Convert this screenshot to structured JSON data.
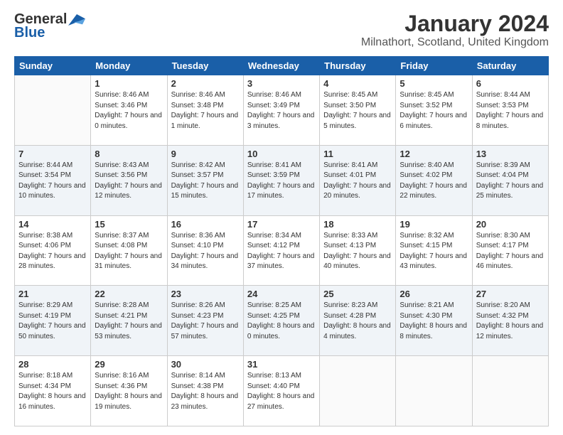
{
  "header": {
    "logo_general": "General",
    "logo_blue": "Blue",
    "month": "January 2024",
    "location": "Milnathort, Scotland, United Kingdom"
  },
  "weekdays": [
    "Sunday",
    "Monday",
    "Tuesday",
    "Wednesday",
    "Thursday",
    "Friday",
    "Saturday"
  ],
  "weeks": [
    [
      {
        "day": "",
        "sunrise": "",
        "sunset": "",
        "daylight": ""
      },
      {
        "day": "1",
        "sunrise": "Sunrise: 8:46 AM",
        "sunset": "Sunset: 3:46 PM",
        "daylight": "Daylight: 7 hours and 0 minutes."
      },
      {
        "day": "2",
        "sunrise": "Sunrise: 8:46 AM",
        "sunset": "Sunset: 3:48 PM",
        "daylight": "Daylight: 7 hours and 1 minute."
      },
      {
        "day": "3",
        "sunrise": "Sunrise: 8:46 AM",
        "sunset": "Sunset: 3:49 PM",
        "daylight": "Daylight: 7 hours and 3 minutes."
      },
      {
        "day": "4",
        "sunrise": "Sunrise: 8:45 AM",
        "sunset": "Sunset: 3:50 PM",
        "daylight": "Daylight: 7 hours and 5 minutes."
      },
      {
        "day": "5",
        "sunrise": "Sunrise: 8:45 AM",
        "sunset": "Sunset: 3:52 PM",
        "daylight": "Daylight: 7 hours and 6 minutes."
      },
      {
        "day": "6",
        "sunrise": "Sunrise: 8:44 AM",
        "sunset": "Sunset: 3:53 PM",
        "daylight": "Daylight: 7 hours and 8 minutes."
      }
    ],
    [
      {
        "day": "7",
        "sunrise": "Sunrise: 8:44 AM",
        "sunset": "Sunset: 3:54 PM",
        "daylight": "Daylight: 7 hours and 10 minutes."
      },
      {
        "day": "8",
        "sunrise": "Sunrise: 8:43 AM",
        "sunset": "Sunset: 3:56 PM",
        "daylight": "Daylight: 7 hours and 12 minutes."
      },
      {
        "day": "9",
        "sunrise": "Sunrise: 8:42 AM",
        "sunset": "Sunset: 3:57 PM",
        "daylight": "Daylight: 7 hours and 15 minutes."
      },
      {
        "day": "10",
        "sunrise": "Sunrise: 8:41 AM",
        "sunset": "Sunset: 3:59 PM",
        "daylight": "Daylight: 7 hours and 17 minutes."
      },
      {
        "day": "11",
        "sunrise": "Sunrise: 8:41 AM",
        "sunset": "Sunset: 4:01 PM",
        "daylight": "Daylight: 7 hours and 20 minutes."
      },
      {
        "day": "12",
        "sunrise": "Sunrise: 8:40 AM",
        "sunset": "Sunset: 4:02 PM",
        "daylight": "Daylight: 7 hours and 22 minutes."
      },
      {
        "day": "13",
        "sunrise": "Sunrise: 8:39 AM",
        "sunset": "Sunset: 4:04 PM",
        "daylight": "Daylight: 7 hours and 25 minutes."
      }
    ],
    [
      {
        "day": "14",
        "sunrise": "Sunrise: 8:38 AM",
        "sunset": "Sunset: 4:06 PM",
        "daylight": "Daylight: 7 hours and 28 minutes."
      },
      {
        "day": "15",
        "sunrise": "Sunrise: 8:37 AM",
        "sunset": "Sunset: 4:08 PM",
        "daylight": "Daylight: 7 hours and 31 minutes."
      },
      {
        "day": "16",
        "sunrise": "Sunrise: 8:36 AM",
        "sunset": "Sunset: 4:10 PM",
        "daylight": "Daylight: 7 hours and 34 minutes."
      },
      {
        "day": "17",
        "sunrise": "Sunrise: 8:34 AM",
        "sunset": "Sunset: 4:12 PM",
        "daylight": "Daylight: 7 hours and 37 minutes."
      },
      {
        "day": "18",
        "sunrise": "Sunrise: 8:33 AM",
        "sunset": "Sunset: 4:13 PM",
        "daylight": "Daylight: 7 hours and 40 minutes."
      },
      {
        "day": "19",
        "sunrise": "Sunrise: 8:32 AM",
        "sunset": "Sunset: 4:15 PM",
        "daylight": "Daylight: 7 hours and 43 minutes."
      },
      {
        "day": "20",
        "sunrise": "Sunrise: 8:30 AM",
        "sunset": "Sunset: 4:17 PM",
        "daylight": "Daylight: 7 hours and 46 minutes."
      }
    ],
    [
      {
        "day": "21",
        "sunrise": "Sunrise: 8:29 AM",
        "sunset": "Sunset: 4:19 PM",
        "daylight": "Daylight: 7 hours and 50 minutes."
      },
      {
        "day": "22",
        "sunrise": "Sunrise: 8:28 AM",
        "sunset": "Sunset: 4:21 PM",
        "daylight": "Daylight: 7 hours and 53 minutes."
      },
      {
        "day": "23",
        "sunrise": "Sunrise: 8:26 AM",
        "sunset": "Sunset: 4:23 PM",
        "daylight": "Daylight: 7 hours and 57 minutes."
      },
      {
        "day": "24",
        "sunrise": "Sunrise: 8:25 AM",
        "sunset": "Sunset: 4:25 PM",
        "daylight": "Daylight: 8 hours and 0 minutes."
      },
      {
        "day": "25",
        "sunrise": "Sunrise: 8:23 AM",
        "sunset": "Sunset: 4:28 PM",
        "daylight": "Daylight: 8 hours and 4 minutes."
      },
      {
        "day": "26",
        "sunrise": "Sunrise: 8:21 AM",
        "sunset": "Sunset: 4:30 PM",
        "daylight": "Daylight: 8 hours and 8 minutes."
      },
      {
        "day": "27",
        "sunrise": "Sunrise: 8:20 AM",
        "sunset": "Sunset: 4:32 PM",
        "daylight": "Daylight: 8 hours and 12 minutes."
      }
    ],
    [
      {
        "day": "28",
        "sunrise": "Sunrise: 8:18 AM",
        "sunset": "Sunset: 4:34 PM",
        "daylight": "Daylight: 8 hours and 16 minutes."
      },
      {
        "day": "29",
        "sunrise": "Sunrise: 8:16 AM",
        "sunset": "Sunset: 4:36 PM",
        "daylight": "Daylight: 8 hours and 19 minutes."
      },
      {
        "day": "30",
        "sunrise": "Sunrise: 8:14 AM",
        "sunset": "Sunset: 4:38 PM",
        "daylight": "Daylight: 8 hours and 23 minutes."
      },
      {
        "day": "31",
        "sunrise": "Sunrise: 8:13 AM",
        "sunset": "Sunset: 4:40 PM",
        "daylight": "Daylight: 8 hours and 27 minutes."
      },
      {
        "day": "",
        "sunrise": "",
        "sunset": "",
        "daylight": ""
      },
      {
        "day": "",
        "sunrise": "",
        "sunset": "",
        "daylight": ""
      },
      {
        "day": "",
        "sunrise": "",
        "sunset": "",
        "daylight": ""
      }
    ]
  ]
}
